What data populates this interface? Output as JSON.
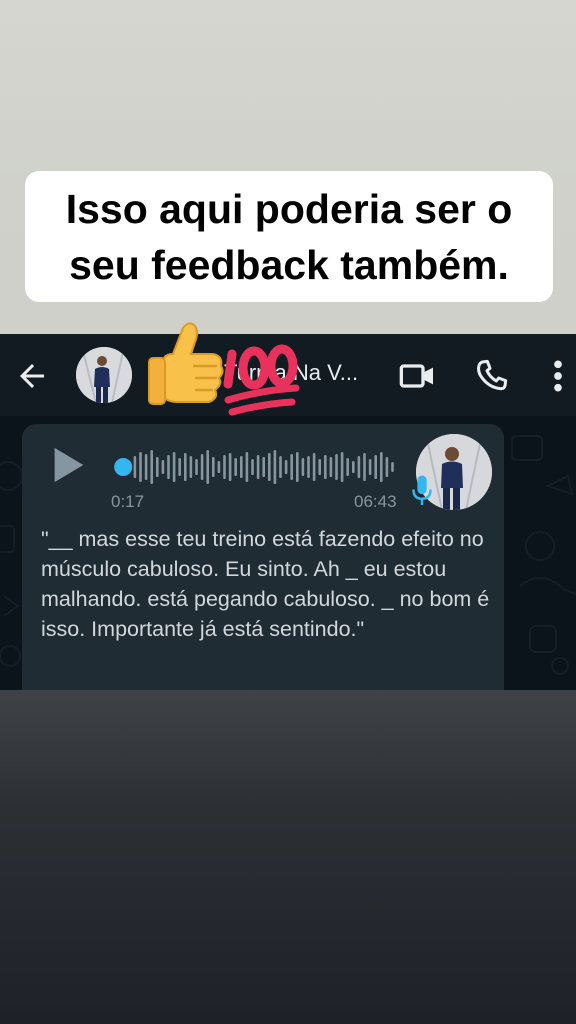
{
  "caption": {
    "line1": "Isso aqui poderia ser o",
    "line2": "seu feedback também."
  },
  "header": {
    "title": "Turma Na V...",
    "back_icon": "arrow-left-icon",
    "video_icon": "video-camera-icon",
    "call_icon": "phone-icon",
    "more_icon": "more-vertical-icon",
    "stickers": [
      "thumbs-up-emoji",
      "hundred-points-emoji"
    ]
  },
  "voice_message": {
    "elapsed": "0:17",
    "duration": "06:43",
    "progress": 0.04,
    "transcript": "\"__ mas esse teu treino está fazendo efeito no músculo cabuloso. Eu sinto. Ah _ eu estou malhando. está pegando cabuloso. _ no bom é isso. Importante já está sentindo.\""
  },
  "colors": {
    "header_bg": "#121b22",
    "bubble_bg": "#202c33",
    "accent_blue": "#34b7f1",
    "text_secondary": "#8696a0"
  }
}
